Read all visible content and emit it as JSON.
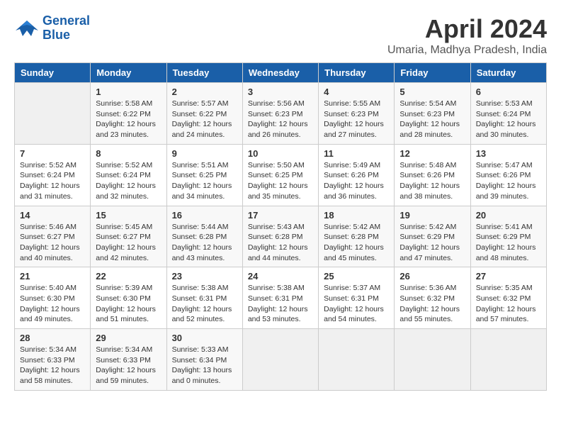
{
  "header": {
    "logo_line1": "General",
    "logo_line2": "Blue",
    "month_year": "April 2024",
    "location": "Umaria, Madhya Pradesh, India"
  },
  "weekdays": [
    "Sunday",
    "Monday",
    "Tuesday",
    "Wednesday",
    "Thursday",
    "Friday",
    "Saturday"
  ],
  "weeks": [
    [
      {
        "day": "",
        "info": ""
      },
      {
        "day": "1",
        "info": "Sunrise: 5:58 AM\nSunset: 6:22 PM\nDaylight: 12 hours\nand 23 minutes."
      },
      {
        "day": "2",
        "info": "Sunrise: 5:57 AM\nSunset: 6:22 PM\nDaylight: 12 hours\nand 24 minutes."
      },
      {
        "day": "3",
        "info": "Sunrise: 5:56 AM\nSunset: 6:23 PM\nDaylight: 12 hours\nand 26 minutes."
      },
      {
        "day": "4",
        "info": "Sunrise: 5:55 AM\nSunset: 6:23 PM\nDaylight: 12 hours\nand 27 minutes."
      },
      {
        "day": "5",
        "info": "Sunrise: 5:54 AM\nSunset: 6:23 PM\nDaylight: 12 hours\nand 28 minutes."
      },
      {
        "day": "6",
        "info": "Sunrise: 5:53 AM\nSunset: 6:24 PM\nDaylight: 12 hours\nand 30 minutes."
      }
    ],
    [
      {
        "day": "7",
        "info": "Sunrise: 5:52 AM\nSunset: 6:24 PM\nDaylight: 12 hours\nand 31 minutes."
      },
      {
        "day": "8",
        "info": "Sunrise: 5:52 AM\nSunset: 6:24 PM\nDaylight: 12 hours\nand 32 minutes."
      },
      {
        "day": "9",
        "info": "Sunrise: 5:51 AM\nSunset: 6:25 PM\nDaylight: 12 hours\nand 34 minutes."
      },
      {
        "day": "10",
        "info": "Sunrise: 5:50 AM\nSunset: 6:25 PM\nDaylight: 12 hours\nand 35 minutes."
      },
      {
        "day": "11",
        "info": "Sunrise: 5:49 AM\nSunset: 6:26 PM\nDaylight: 12 hours\nand 36 minutes."
      },
      {
        "day": "12",
        "info": "Sunrise: 5:48 AM\nSunset: 6:26 PM\nDaylight: 12 hours\nand 38 minutes."
      },
      {
        "day": "13",
        "info": "Sunrise: 5:47 AM\nSunset: 6:26 PM\nDaylight: 12 hours\nand 39 minutes."
      }
    ],
    [
      {
        "day": "14",
        "info": "Sunrise: 5:46 AM\nSunset: 6:27 PM\nDaylight: 12 hours\nand 40 minutes."
      },
      {
        "day": "15",
        "info": "Sunrise: 5:45 AM\nSunset: 6:27 PM\nDaylight: 12 hours\nand 42 minutes."
      },
      {
        "day": "16",
        "info": "Sunrise: 5:44 AM\nSunset: 6:28 PM\nDaylight: 12 hours\nand 43 minutes."
      },
      {
        "day": "17",
        "info": "Sunrise: 5:43 AM\nSunset: 6:28 PM\nDaylight: 12 hours\nand 44 minutes."
      },
      {
        "day": "18",
        "info": "Sunrise: 5:42 AM\nSunset: 6:28 PM\nDaylight: 12 hours\nand 45 minutes."
      },
      {
        "day": "19",
        "info": "Sunrise: 5:42 AM\nSunset: 6:29 PM\nDaylight: 12 hours\nand 47 minutes."
      },
      {
        "day": "20",
        "info": "Sunrise: 5:41 AM\nSunset: 6:29 PM\nDaylight: 12 hours\nand 48 minutes."
      }
    ],
    [
      {
        "day": "21",
        "info": "Sunrise: 5:40 AM\nSunset: 6:30 PM\nDaylight: 12 hours\nand 49 minutes."
      },
      {
        "day": "22",
        "info": "Sunrise: 5:39 AM\nSunset: 6:30 PM\nDaylight: 12 hours\nand 51 minutes."
      },
      {
        "day": "23",
        "info": "Sunrise: 5:38 AM\nSunset: 6:31 PM\nDaylight: 12 hours\nand 52 minutes."
      },
      {
        "day": "24",
        "info": "Sunrise: 5:38 AM\nSunset: 6:31 PM\nDaylight: 12 hours\nand 53 minutes."
      },
      {
        "day": "25",
        "info": "Sunrise: 5:37 AM\nSunset: 6:31 PM\nDaylight: 12 hours\nand 54 minutes."
      },
      {
        "day": "26",
        "info": "Sunrise: 5:36 AM\nSunset: 6:32 PM\nDaylight: 12 hours\nand 55 minutes."
      },
      {
        "day": "27",
        "info": "Sunrise: 5:35 AM\nSunset: 6:32 PM\nDaylight: 12 hours\nand 57 minutes."
      }
    ],
    [
      {
        "day": "28",
        "info": "Sunrise: 5:34 AM\nSunset: 6:33 PM\nDaylight: 12 hours\nand 58 minutes."
      },
      {
        "day": "29",
        "info": "Sunrise: 5:34 AM\nSunset: 6:33 PM\nDaylight: 12 hours\nand 59 minutes."
      },
      {
        "day": "30",
        "info": "Sunrise: 5:33 AM\nSunset: 6:34 PM\nDaylight: 13 hours\nand 0 minutes."
      },
      {
        "day": "",
        "info": ""
      },
      {
        "day": "",
        "info": ""
      },
      {
        "day": "",
        "info": ""
      },
      {
        "day": "",
        "info": ""
      }
    ]
  ]
}
